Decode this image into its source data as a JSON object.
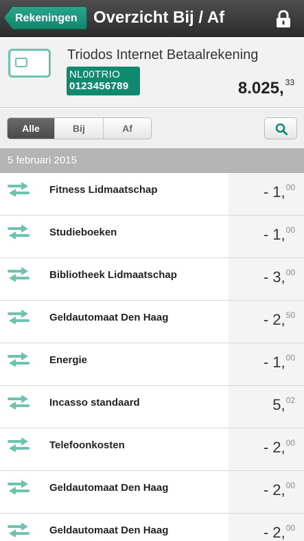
{
  "topbar": {
    "back_label": "Rekeningen",
    "title": "Overzicht Bij / Af",
    "lock_icon": "lock-icon"
  },
  "account": {
    "name": "Triodos Internet Betaalrekening",
    "iban_line1": "NL00TRIO",
    "iban_line2": "0123456789",
    "balance_main": "8.025,",
    "balance_cents": "33",
    "card_icon": "bank-card-icon"
  },
  "filter": {
    "tabs": [
      "Alle",
      "Bij",
      "Af"
    ],
    "active": "Alle",
    "search_icon": "search-icon"
  },
  "date_header": "5 februari 2015",
  "transactions": [
    {
      "description": "Fitness Lidmaatschap",
      "amount_main": "- 1,",
      "amount_cents": "00"
    },
    {
      "description": "Studieboeken",
      "amount_main": "- 1,",
      "amount_cents": "00"
    },
    {
      "description": "Bibliotheek Lidmaatschap",
      "amount_main": "- 3,",
      "amount_cents": "00"
    },
    {
      "description": "Geldautomaat Den Haag",
      "amount_main": "- 2,",
      "amount_cents": "50"
    },
    {
      "description": "Energie",
      "amount_main": "- 1,",
      "amount_cents": "00"
    },
    {
      "description": "Incasso standaard",
      "amount_main": "5,",
      "amount_cents": "02"
    },
    {
      "description": "Telefoonkosten",
      "amount_main": "- 2,",
      "amount_cents": "00"
    },
    {
      "description": "Geldautomaat Den Haag",
      "amount_main": "- 2,",
      "amount_cents": "00"
    },
    {
      "description": "Geldautomaat Den Haag",
      "amount_main": "- 2,",
      "amount_cents": "00"
    }
  ],
  "colors": {
    "accent": "#0f8a6f",
    "icon_teal": "#6fc2ad",
    "topbar": "#3a3a3a"
  }
}
